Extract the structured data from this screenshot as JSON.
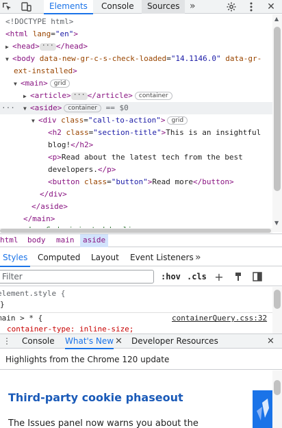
{
  "toolbar": {
    "tabs": [
      {
        "label": "Elements"
      },
      {
        "label": "Console"
      },
      {
        "label": "Sources"
      }
    ],
    "more": "»",
    "accent": "#1a73e8"
  },
  "tree": {
    "doctype": "<!DOCTYPE html>",
    "html_open": {
      "tag": "html",
      "attr": "lang",
      "val": "\"en\""
    },
    "head": {
      "open": "<head>",
      "close": "</head>"
    },
    "body": {
      "attr1": "data-new-gr-c-s-check-loaded",
      "val1": "\"14.1146.0\"",
      "attr2_a": "data-gr-",
      "attr2_b": "ext-installed"
    },
    "main_open": "<main>",
    "main_badge": "grid",
    "article": {
      "open": "<article>",
      "close": "</article>",
      "badge": "container"
    },
    "aside": {
      "open": "<aside>",
      "badge": "container",
      "eq": "== $0"
    },
    "div": {
      "tag": "div",
      "attr": "class",
      "val": "\"call-to-action\"",
      "badge": "grid"
    },
    "h2": {
      "tag": "h2",
      "attr": "class",
      "val": "\"section-title\"",
      "text_a": "This is an insightful",
      "text_b": "blog!",
      "close": "</h2>"
    },
    "p": {
      "open": "<p>",
      "text_a": "Read about the latest tech from the best",
      "text_b": "developers.",
      "close": "</p>"
    },
    "button": {
      "tag": "button",
      "attr": "class",
      "val": "\"button\"",
      "text": "Read more",
      "close": "</button>"
    },
    "div_close": "</div>",
    "aside_close": "</aside>",
    "main_close": "</main>",
    "comment": "<!-- Code injected by live-server -->"
  },
  "breadcrumb": [
    "html",
    "body",
    "main",
    "aside"
  ],
  "styles_tabs": [
    {
      "label": "Styles"
    },
    {
      "label": "Computed"
    },
    {
      "label": "Layout"
    },
    {
      "label": "Event Listeners"
    }
  ],
  "filter": {
    "placeholder": "Filter",
    "hov": ":hov",
    "cls": ".cls"
  },
  "styles": {
    "element_style": "element.style {",
    "close_brace": "}",
    "rule_selector": "main > * {",
    "rule_source": "containerQuery.css:32",
    "rule_prop": "container-type: inline-size;"
  },
  "drawer": {
    "tabs": [
      {
        "label": "Console"
      },
      {
        "label": "What's New"
      },
      {
        "label": "Developer Resources"
      }
    ]
  },
  "whats_new": {
    "header": "Highlights from the Chrome 120 update",
    "heading": "Third-party cookie phaseout",
    "body": "The Issues panel now warns you about the"
  }
}
